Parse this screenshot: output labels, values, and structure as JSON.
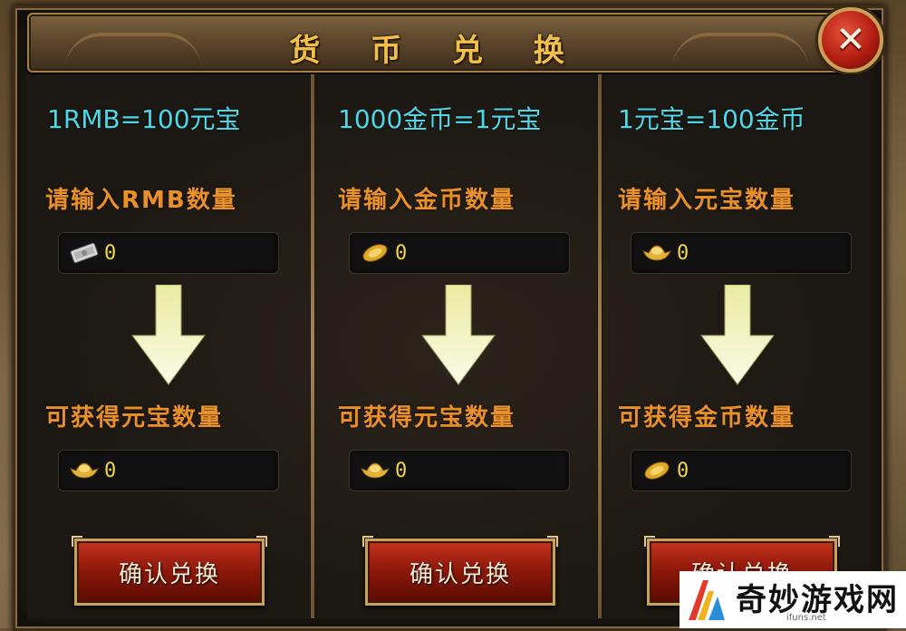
{
  "dialog": {
    "title": "货 币 兑 换",
    "close_label": "✕"
  },
  "columns": [
    {
      "rate": "1RMB=100元宝",
      "input_label": "请输入RMB数量",
      "input_icon": "banknote-icon",
      "input_value": "0",
      "output_label": "可获得元宝数量",
      "output_icon": "gold-ingot-icon",
      "output_value": "0",
      "button_label": "确认兑换"
    },
    {
      "rate": "1000金币=1元宝",
      "input_label": "请输入金币数量",
      "input_icon": "gold-coin-icon",
      "input_value": "0",
      "output_label": "可获得元宝数量",
      "output_icon": "gold-ingot-icon",
      "output_value": "0",
      "button_label": "确认兑换"
    },
    {
      "rate": "1元宝=100金币",
      "input_label": "请输入元宝数量",
      "input_icon": "gold-ingot-icon",
      "input_value": "0",
      "output_label": "可获得金币数量",
      "output_icon": "gold-coin-icon",
      "output_value": "0",
      "button_label": "确认兑换"
    }
  ],
  "watermark": {
    "name": "奇妙游戏网",
    "url": "ifuns.net"
  },
  "colors": {
    "rate_text": "#4dd8e8",
    "label_text": "#e8902a",
    "value_text": "#f3d449",
    "title_text": "#f2c04a",
    "button_red": "#8a1709"
  }
}
